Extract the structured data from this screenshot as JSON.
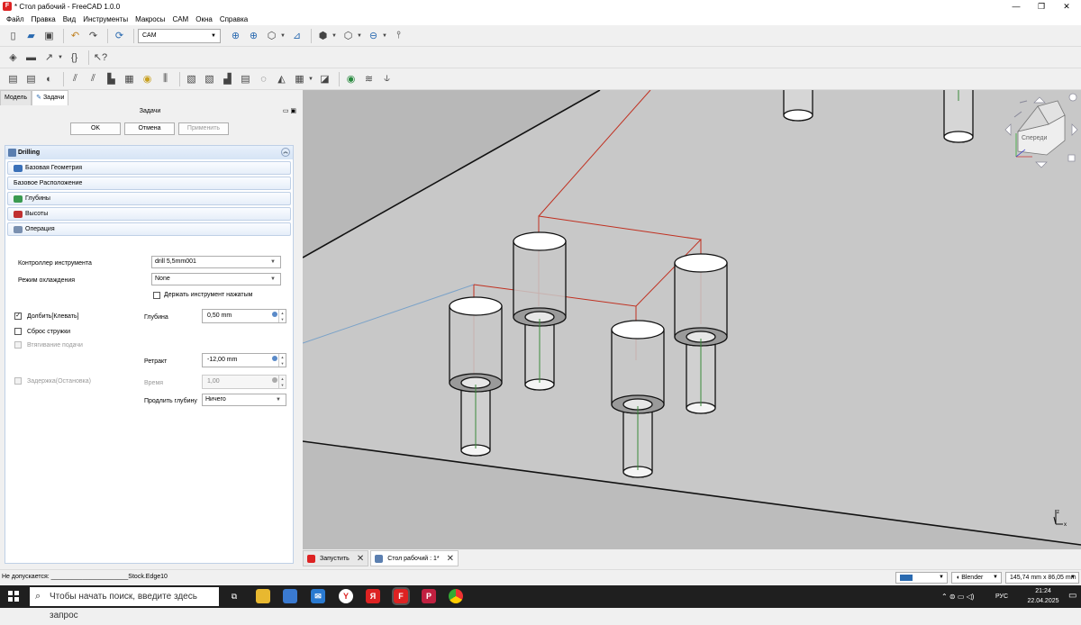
{
  "window": {
    "title": "* Стол рабочий - FreeCAD 1.0.0",
    "min": "—",
    "max": "❐",
    "close": "✕"
  },
  "menu": [
    "Файл",
    "Правка",
    "Вид",
    "Инструменты",
    "Макросы",
    "CAM",
    "Окна",
    "Справка"
  ],
  "toolbar": {
    "workbench": "CAM"
  },
  "panel": {
    "tabs": [
      "Модель",
      "Задачи"
    ],
    "header": "Задачи",
    "buttons": {
      "ok": "OK",
      "cancel": "Отмена",
      "apply": "Применить"
    },
    "title": "Drilling",
    "sections": [
      "Базовая Геометрия",
      "Базовое Расположение",
      "Глубины",
      "Высоты",
      "Операция"
    ],
    "fields": {
      "tool_controller_label": "Контроллер инструмента",
      "tool_controller_value": "drill 5,5mm001",
      "coolant_label": "Режим охлаждения",
      "coolant_value": "None",
      "keep_tool_down": "Держать инструмент нажатым",
      "peck": "Долбить[Клевать]",
      "chip_break": "Сброс стружки",
      "feed_retract": "Втягивание подачи",
      "dwell": "Задержка(Остановка)",
      "depth_label": "Глубина",
      "depth_value": "0,50 mm",
      "retract_label": "Ретракт",
      "retract_value": "-12,00 mm",
      "time_label": "Время",
      "time_value": "1,00",
      "extend_label": "Продлить глубину",
      "extend_value": "Ничего"
    }
  },
  "navcube": {
    "face": "Спереди"
  },
  "doctabs": [
    {
      "label": "Запустить"
    },
    {
      "label": "Стол рабочий : 1*"
    }
  ],
  "status": {
    "message": "Не допускается: ______________________Stock.Edge10",
    "nav_style": "Blender",
    "dimensions": "145,74 mm x 86,05 mm"
  },
  "taskbar": {
    "search_placeholder": "Чтобы начать поиск, введите здесь запрос",
    "lang": "РУС",
    "time": "21:24",
    "date": "22.04.2025"
  }
}
